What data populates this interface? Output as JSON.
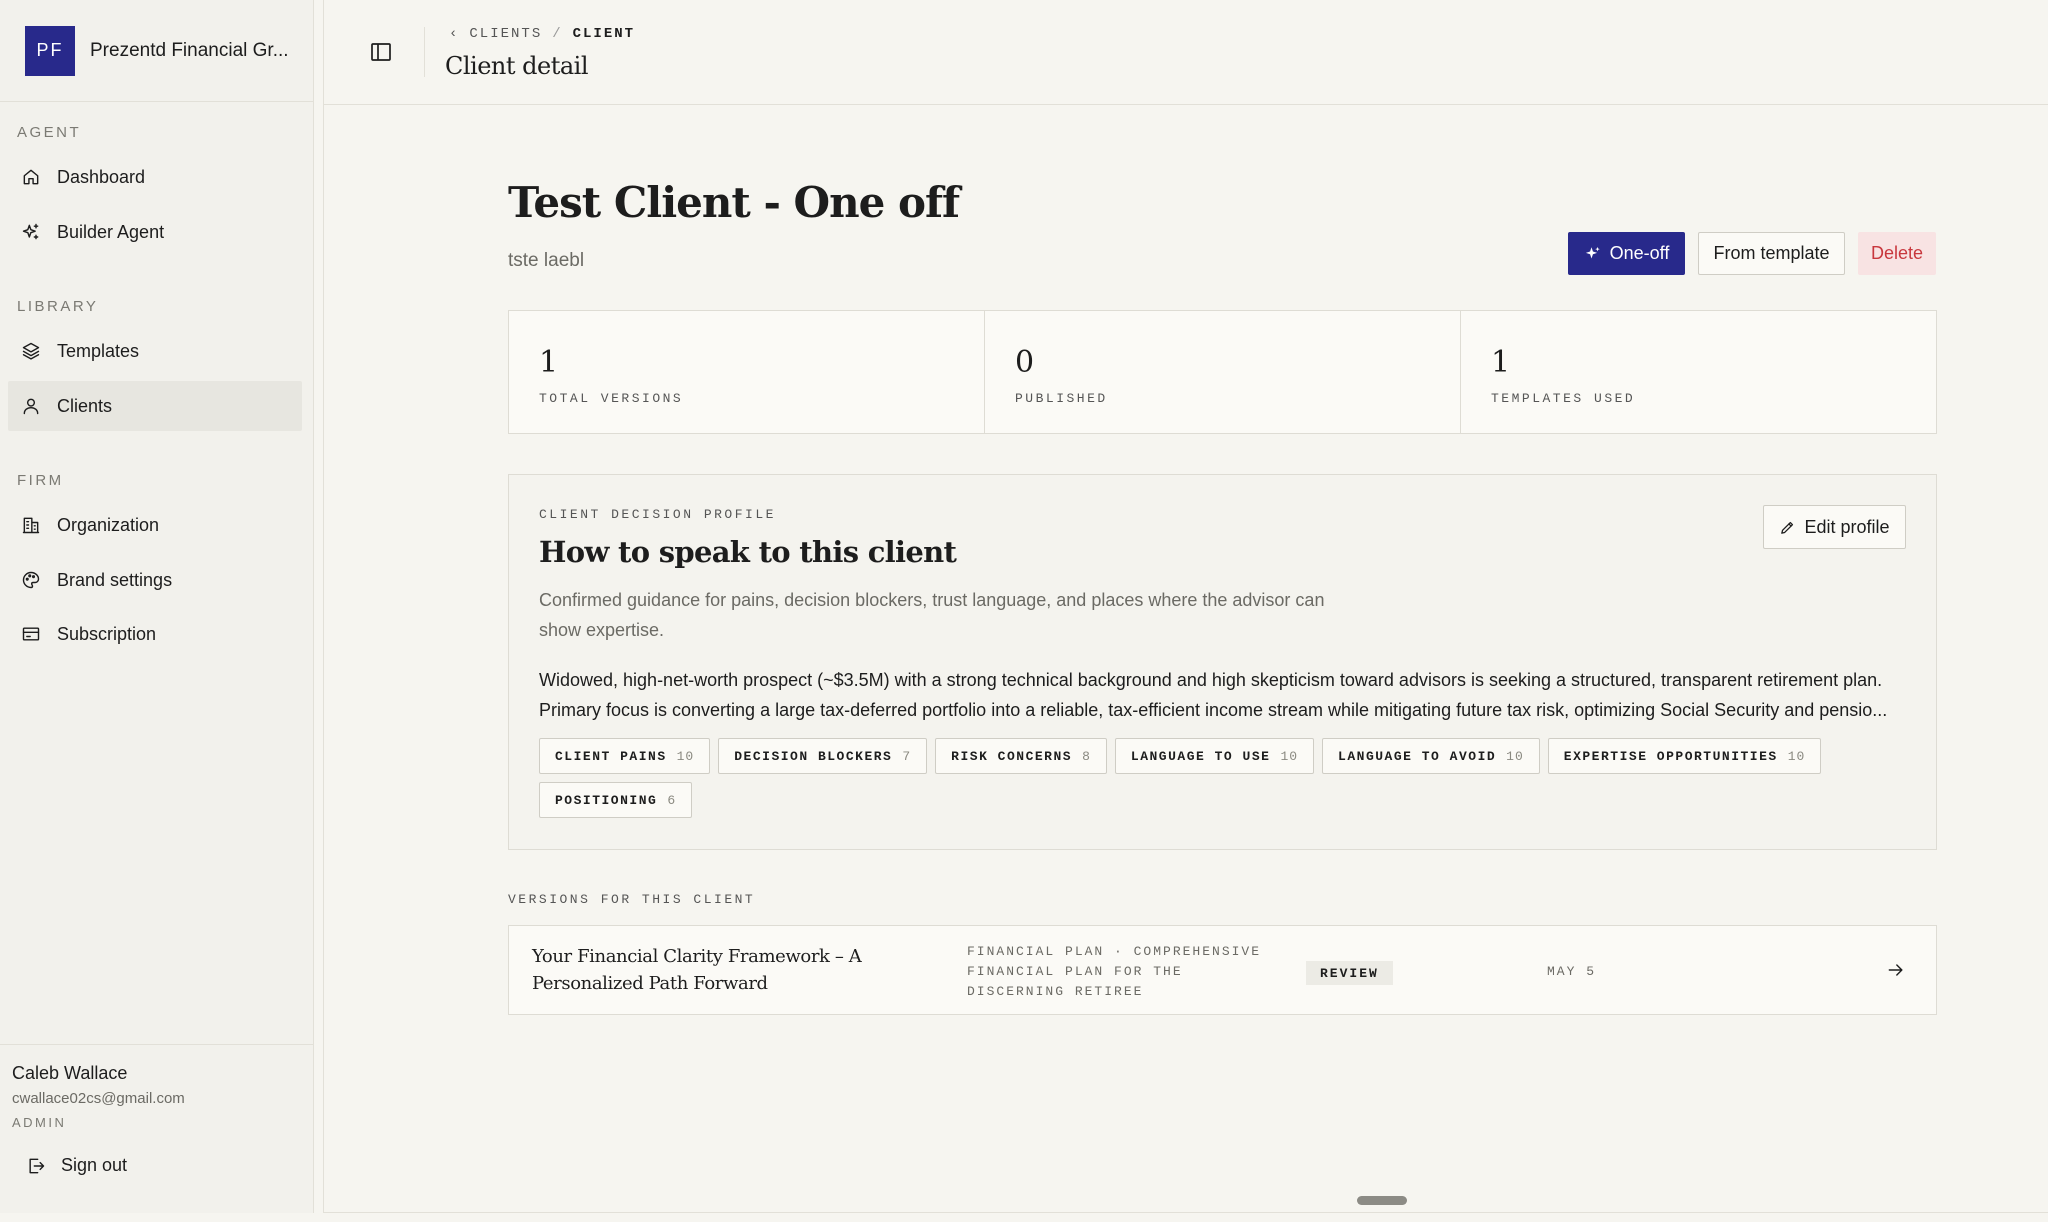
{
  "sidebar": {
    "brand": {
      "logo": "PF",
      "name": "Prezentd Financial Gr..."
    },
    "sections": [
      {
        "label": "AGENT",
        "items": [
          {
            "label": "Dashboard",
            "icon": "home-icon"
          },
          {
            "label": "Builder Agent",
            "icon": "sparkle-icon"
          }
        ]
      },
      {
        "label": "LIBRARY",
        "items": [
          {
            "label": "Templates",
            "icon": "layers-icon"
          },
          {
            "label": "Clients",
            "icon": "user-icon",
            "active": true
          }
        ]
      },
      {
        "label": "FIRM",
        "items": [
          {
            "label": "Organization",
            "icon": "building-icon"
          },
          {
            "label": "Brand settings",
            "icon": "palette-icon"
          },
          {
            "label": "Subscription",
            "icon": "card-icon"
          }
        ]
      }
    ],
    "user": {
      "name": "Caleb Wallace",
      "email": "cwallace02cs@gmail.com",
      "role": "ADMIN"
    },
    "signout": "Sign out"
  },
  "topbar": {
    "breadcrumb": {
      "parent": "CLIENTS",
      "separator": "/",
      "current": "CLIENT"
    },
    "title": "Client detail"
  },
  "client": {
    "title": "Test Client - One off",
    "subtitle": "tste laebl",
    "actions": {
      "primary": "One-off",
      "secondary": "From template",
      "danger": "Delete"
    }
  },
  "stats": [
    {
      "value": "1",
      "label": "TOTAL VERSIONS"
    },
    {
      "value": "0",
      "label": "PUBLISHED"
    },
    {
      "value": "1",
      "label": "TEMPLATES USED"
    }
  ],
  "profile": {
    "label": "CLIENT DECISION PROFILE",
    "title": "How to speak to this client",
    "description": "Confirmed guidance for pains, decision blockers, trust language, and places where the advisor can show expertise.",
    "summary_line1": "Widowed, high-net-worth prospect (~$3.5M) with a strong technical background and high skepticism toward advisors is seeking a structured, transparent retirement plan.",
    "summary_line2": "Primary focus is converting a large tax-deferred portfolio into a reliable, tax-efficient income stream while mitigating future tax risk, optimizing Social Security and pensio...",
    "edit_label": "Edit profile",
    "tags": [
      {
        "label": "CLIENT PAINS",
        "count": "10"
      },
      {
        "label": "DECISION BLOCKERS",
        "count": "7"
      },
      {
        "label": "RISK CONCERNS",
        "count": "8"
      },
      {
        "label": "LANGUAGE TO USE",
        "count": "10"
      },
      {
        "label": "LANGUAGE TO AVOID",
        "count": "10"
      },
      {
        "label": "EXPERTISE OPPORTUNITIES",
        "count": "10"
      },
      {
        "label": "POSITIONING",
        "count": "6"
      }
    ]
  },
  "versions": {
    "label": "VERSIONS FOR THIS CLIENT",
    "items": [
      {
        "title": "Your Financial Clarity Framework – A Personalized Path Forward",
        "meta": "FINANCIAL PLAN · COMPREHENSIVE FINANCIAL PLAN FOR THE DISCERNING RETIREE",
        "status": "REVIEW",
        "date": "MAY 5"
      }
    ]
  },
  "colors": {
    "brand": "#28298b",
    "danger_text": "#c8373d",
    "danger_bg": "#f8e3e3",
    "background": "#f6f5f0"
  }
}
